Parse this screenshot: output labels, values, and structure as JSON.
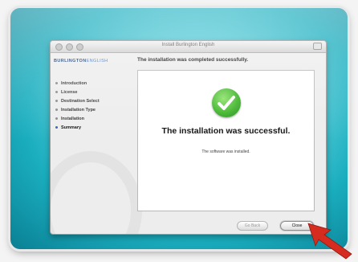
{
  "window": {
    "title": "Install Burlington English",
    "brand_primary": "BURLINGTON",
    "brand_secondary": "ENGLISH"
  },
  "header": {
    "status": "The installation was completed successfully."
  },
  "sidebar": {
    "items": [
      {
        "label": "Introduction",
        "active": false
      },
      {
        "label": "License",
        "active": false
      },
      {
        "label": "Destination Select",
        "active": false
      },
      {
        "label": "Installation Type",
        "active": false
      },
      {
        "label": "Installation",
        "active": false
      },
      {
        "label": "Summary",
        "active": true
      }
    ]
  },
  "content": {
    "success_message": "The installation was successful.",
    "sub_message": "The software was installed."
  },
  "buttons": {
    "go_back": "Go Back",
    "close": "Close"
  },
  "colors": {
    "accent": "#2a63c9",
    "success": "#3fb52a",
    "arrow": "#d62b1f"
  }
}
